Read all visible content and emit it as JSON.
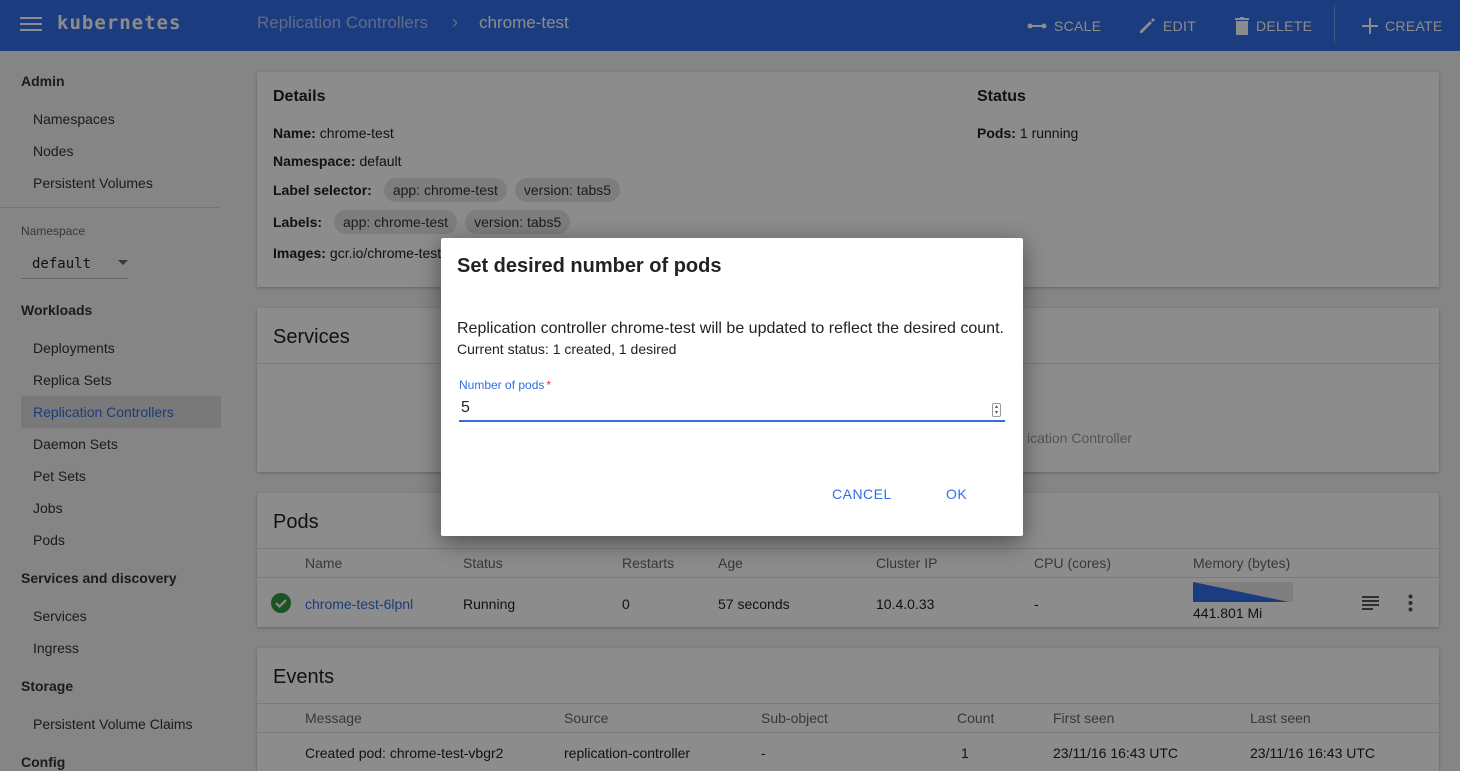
{
  "app": {
    "brand": "kubernetes"
  },
  "breadcrumb": {
    "parent": "Replication Controllers",
    "separator": "›",
    "current": "chrome-test"
  },
  "actions": {
    "scale": "SCALE",
    "edit": "EDIT",
    "delete": "DELETE",
    "create": "CREATE"
  },
  "sidebar": {
    "admin": {
      "title": "Admin",
      "items": [
        "Namespaces",
        "Nodes",
        "Persistent Volumes"
      ]
    },
    "namespace": {
      "label": "Namespace",
      "value": "default"
    },
    "workloads": {
      "title": "Workloads",
      "items": [
        "Deployments",
        "Replica Sets",
        "Replication Controllers",
        "Daemon Sets",
        "Pet Sets",
        "Jobs",
        "Pods"
      ],
      "active": "Replication Controllers"
    },
    "services": {
      "title": "Services and discovery",
      "items": [
        "Services",
        "Ingress"
      ]
    },
    "storage": {
      "title": "Storage",
      "items": [
        "Persistent Volume Claims"
      ]
    },
    "config": {
      "title": "Config"
    }
  },
  "details": {
    "title": "Details",
    "name_label": "Name:",
    "name": "chrome-test",
    "namespace_label": "Namespace:",
    "namespace": "default",
    "selector_label": "Label selector:",
    "selector": [
      "app: chrome-test",
      "version: tabs5"
    ],
    "labels_label": "Labels:",
    "labels": [
      "app: chrome-test",
      "version: tabs5"
    ],
    "images_label": "Images:",
    "images": "gcr.io/chrome-test"
  },
  "status": {
    "title": "Status",
    "pods_label": "Pods:",
    "pods": "1 running"
  },
  "services_card": {
    "title": "Services",
    "empty_hint": "ication Controller"
  },
  "pods": {
    "title": "Pods",
    "columns": [
      "Name",
      "Status",
      "Restarts",
      "Age",
      "Cluster IP",
      "CPU (cores)",
      "Memory (bytes)"
    ],
    "rows": [
      {
        "name": "chrome-test-6lpnl",
        "status": "Running",
        "restarts": "0",
        "age": "57 seconds",
        "ip": "10.4.0.33",
        "cpu": "-",
        "memory": "441.801 Mi"
      }
    ]
  },
  "events": {
    "title": "Events",
    "columns": [
      "Message",
      "Source",
      "Sub-object",
      "Count",
      "First seen",
      "Last seen"
    ],
    "rows": [
      {
        "message": "Created pod: chrome-test-vbgr2",
        "source": "replication-controller",
        "subobject": "-",
        "count": "1",
        "first": "23/11/16 16:43 UTC",
        "last": "23/11/16 16:43 UTC"
      }
    ]
  },
  "dialog": {
    "title": "Set desired number of pods",
    "message": "Replication controller chrome-test will be updated to reflect the desired count.",
    "status": "Current status: 1 created, 1 desired",
    "field_label": "Number of pods",
    "required_mark": "*",
    "value": "5",
    "cancel": "CANCEL",
    "ok": "OK"
  },
  "colors": {
    "primary": "#326de6",
    "success": "#2e9a3e"
  }
}
